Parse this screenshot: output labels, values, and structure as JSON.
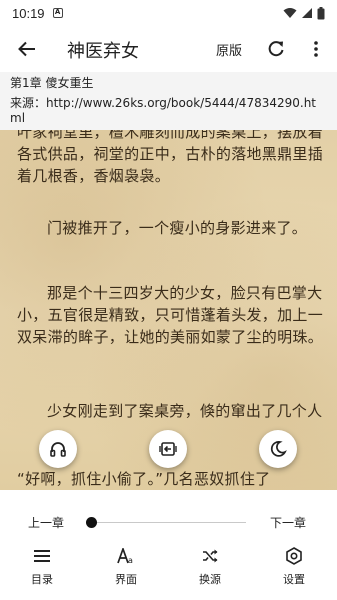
{
  "status": {
    "time": "10:19",
    "notification_icon": "A"
  },
  "toolbar": {
    "title": "神医弃女",
    "origin_label": "原版"
  },
  "info": {
    "chapter": "第1章 傻女重生",
    "source": "来源：http://www.26ks.org/book/5444/47834290.html"
  },
  "content": {
    "paragraphs": [
      "叶家祠堂里，檀木雕刻而成的案桌上，摆放着各式供品，祠堂的正中，古朴的落地黑鼎里插着几根香，香烟袅袅。",
      "门被推开了，一个瘦小的身影进来了。",
      "那是个十三四岁大的少女，脸只有巴掌大小，五官很是精致，只可惜蓬着头发，加上一双呆滞的眸子，让她的美丽如蒙了尘的明珠。",
      "少女刚走到了案桌旁，倏的窜出了几个人",
      "“好啊，抓住小偷了。”几名恶奴抓住了"
    ]
  },
  "nav": {
    "prev": "上一章",
    "next": "下一章"
  },
  "menu": [
    {
      "label": "目录",
      "icon": "list-icon"
    },
    {
      "label": "界面",
      "icon": "font-icon"
    },
    {
      "label": "换源",
      "icon": "shuffle-icon"
    },
    {
      "label": "设置",
      "icon": "settings-icon"
    }
  ],
  "colors": {
    "page_bg": "#e5d4ad",
    "text": "#3a2c1a",
    "panel": "#ffffff"
  }
}
